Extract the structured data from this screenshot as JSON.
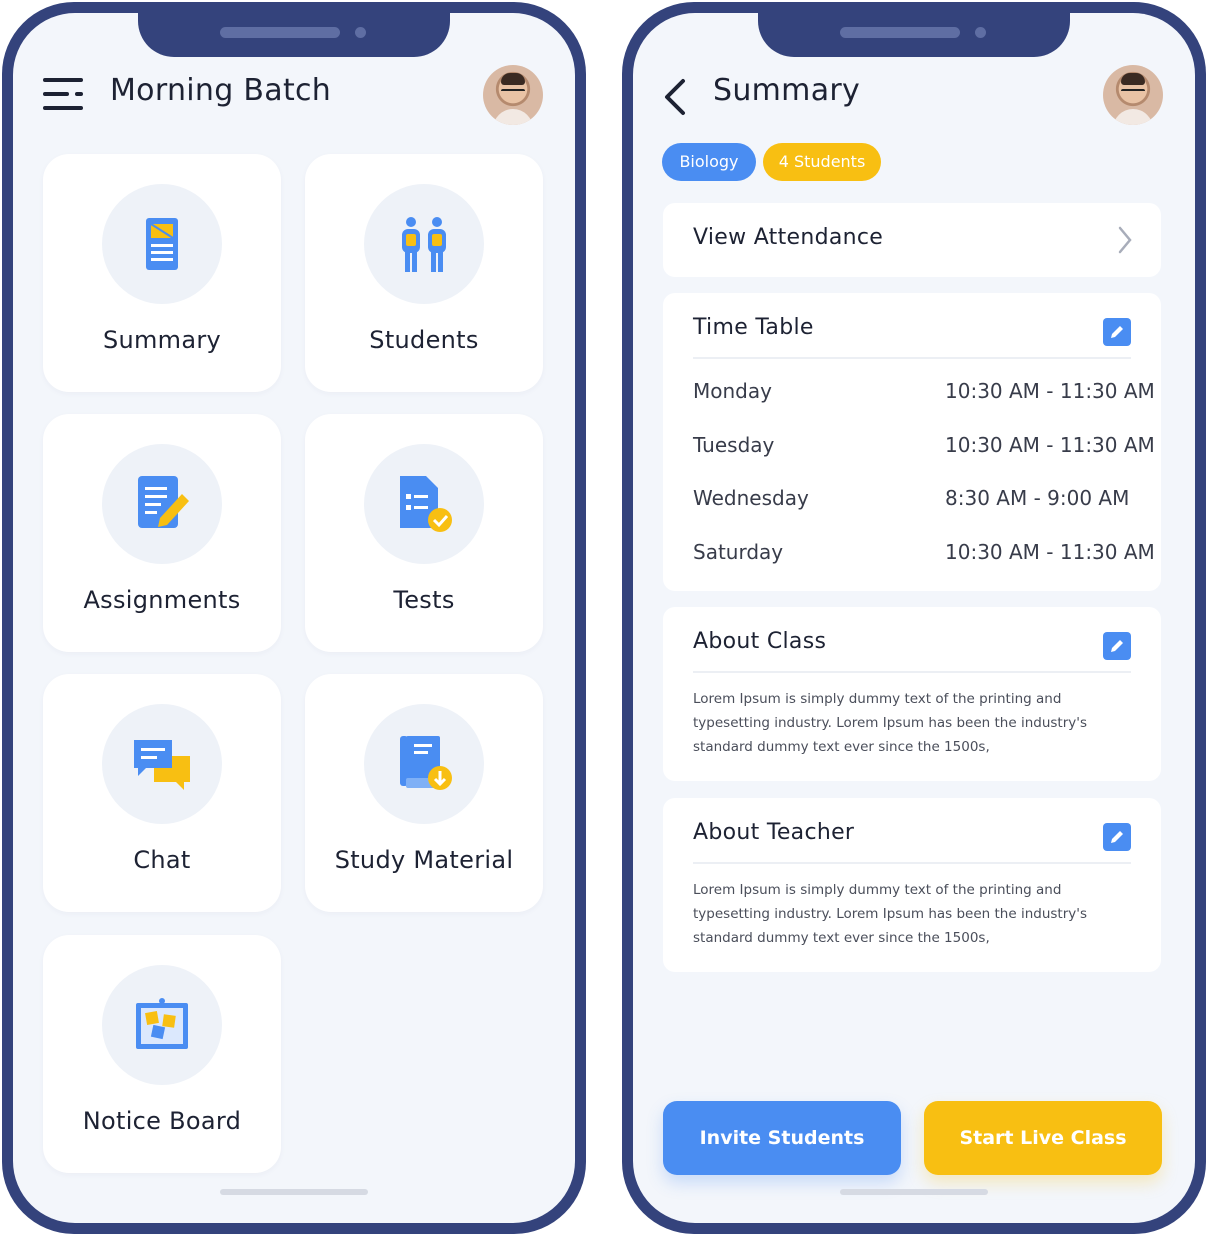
{
  "left_screen": {
    "title": "Morning Batch",
    "menu_icon": "menu-icon",
    "avatar": "user-avatar",
    "tiles": [
      {
        "label": "Summary",
        "icon": "summary-document-icon"
      },
      {
        "label": "Students",
        "icon": "students-icon"
      },
      {
        "label": "Assignments",
        "icon": "assignment-edit-icon"
      },
      {
        "label": "Tests",
        "icon": "test-check-icon"
      },
      {
        "label": "Chat",
        "icon": "chat-bubbles-icon"
      },
      {
        "label": "Study Material",
        "icon": "book-download-icon"
      },
      {
        "label": "Notice Board",
        "icon": "notice-board-icon"
      }
    ]
  },
  "right_screen": {
    "title": "Summary",
    "back_icon": "chevron-left-icon",
    "chips": [
      "Biology",
      "4 Students"
    ],
    "attendance": {
      "label": "View Attendance",
      "icon": "chevron-right-icon"
    },
    "timetable": {
      "title": "Time Table",
      "rows": [
        {
          "day": "Monday",
          "time": "10:30 AM - 11:30 AM"
        },
        {
          "day": "Tuesday",
          "time": "10:30 AM - 11:30 AM"
        },
        {
          "day": "Wednesday",
          "time": "8:30 AM - 9:00 AM"
        },
        {
          "day": "Saturday",
          "time": "10:30 AM - 11:30 AM"
        }
      ]
    },
    "about_class": {
      "title": "About Class",
      "text": "Lorem Ipsum is simply dummy text of the printing and typesetting industry. Lorem Ipsum has been the industry's standard dummy text ever since the 1500s,"
    },
    "about_teacher": {
      "title": "About Teacher",
      "text": "Lorem Ipsum is simply dummy text of the printing and typesetting industry. Lorem Ipsum has been the industry's standard dummy text ever since the 1500s,"
    },
    "buttons": {
      "invite": "Invite Students",
      "start": "Start Live Class"
    }
  },
  "colors": {
    "frame": "#34437c",
    "background": "#f3f6fb",
    "blue": "#4a8df2",
    "yellow": "#f8bf12"
  }
}
